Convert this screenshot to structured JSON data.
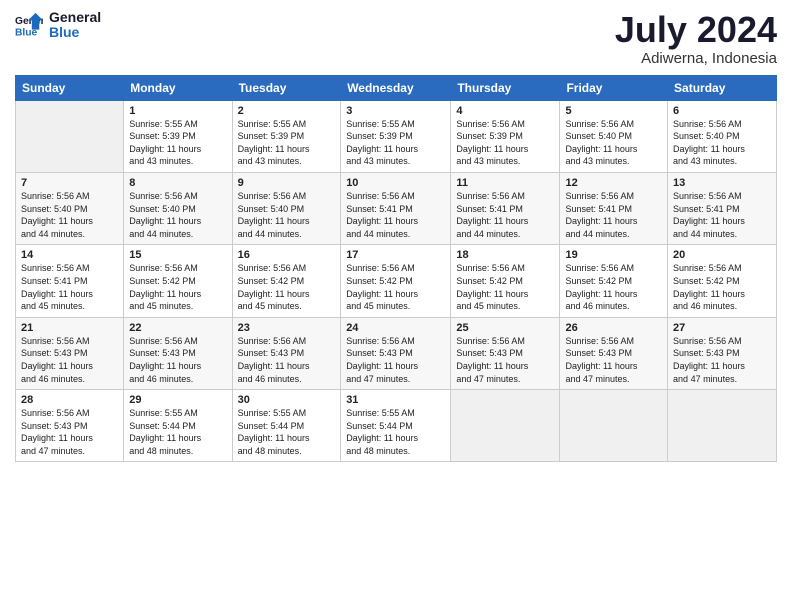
{
  "header": {
    "logo_line1": "General",
    "logo_line2": "Blue",
    "title": "July 2024",
    "location": "Adiwerna, Indonesia"
  },
  "weekdays": [
    "Sunday",
    "Monday",
    "Tuesday",
    "Wednesday",
    "Thursday",
    "Friday",
    "Saturday"
  ],
  "weeks": [
    [
      {
        "day": "",
        "sunrise": "",
        "sunset": "",
        "daylight": ""
      },
      {
        "day": "1",
        "sunrise": "Sunrise: 5:55 AM",
        "sunset": "Sunset: 5:39 PM",
        "daylight": "Daylight: 11 hours and 43 minutes."
      },
      {
        "day": "2",
        "sunrise": "Sunrise: 5:55 AM",
        "sunset": "Sunset: 5:39 PM",
        "daylight": "Daylight: 11 hours and 43 minutes."
      },
      {
        "day": "3",
        "sunrise": "Sunrise: 5:55 AM",
        "sunset": "Sunset: 5:39 PM",
        "daylight": "Daylight: 11 hours and 43 minutes."
      },
      {
        "day": "4",
        "sunrise": "Sunrise: 5:56 AM",
        "sunset": "Sunset: 5:39 PM",
        "daylight": "Daylight: 11 hours and 43 minutes."
      },
      {
        "day": "5",
        "sunrise": "Sunrise: 5:56 AM",
        "sunset": "Sunset: 5:40 PM",
        "daylight": "Daylight: 11 hours and 43 minutes."
      },
      {
        "day": "6",
        "sunrise": "Sunrise: 5:56 AM",
        "sunset": "Sunset: 5:40 PM",
        "daylight": "Daylight: 11 hours and 43 minutes."
      }
    ],
    [
      {
        "day": "7",
        "sunrise": "Sunrise: 5:56 AM",
        "sunset": "Sunset: 5:40 PM",
        "daylight": "Daylight: 11 hours and 44 minutes."
      },
      {
        "day": "8",
        "sunrise": "Sunrise: 5:56 AM",
        "sunset": "Sunset: 5:40 PM",
        "daylight": "Daylight: 11 hours and 44 minutes."
      },
      {
        "day": "9",
        "sunrise": "Sunrise: 5:56 AM",
        "sunset": "Sunset: 5:40 PM",
        "daylight": "Daylight: 11 hours and 44 minutes."
      },
      {
        "day": "10",
        "sunrise": "Sunrise: 5:56 AM",
        "sunset": "Sunset: 5:41 PM",
        "daylight": "Daylight: 11 hours and 44 minutes."
      },
      {
        "day": "11",
        "sunrise": "Sunrise: 5:56 AM",
        "sunset": "Sunset: 5:41 PM",
        "daylight": "Daylight: 11 hours and 44 minutes."
      },
      {
        "day": "12",
        "sunrise": "Sunrise: 5:56 AM",
        "sunset": "Sunset: 5:41 PM",
        "daylight": "Daylight: 11 hours and 44 minutes."
      },
      {
        "day": "13",
        "sunrise": "Sunrise: 5:56 AM",
        "sunset": "Sunset: 5:41 PM",
        "daylight": "Daylight: 11 hours and 44 minutes."
      }
    ],
    [
      {
        "day": "14",
        "sunrise": "Sunrise: 5:56 AM",
        "sunset": "Sunset: 5:41 PM",
        "daylight": "Daylight: 11 hours and 45 minutes."
      },
      {
        "day": "15",
        "sunrise": "Sunrise: 5:56 AM",
        "sunset": "Sunset: 5:42 PM",
        "daylight": "Daylight: 11 hours and 45 minutes."
      },
      {
        "day": "16",
        "sunrise": "Sunrise: 5:56 AM",
        "sunset": "Sunset: 5:42 PM",
        "daylight": "Daylight: 11 hours and 45 minutes."
      },
      {
        "day": "17",
        "sunrise": "Sunrise: 5:56 AM",
        "sunset": "Sunset: 5:42 PM",
        "daylight": "Daylight: 11 hours and 45 minutes."
      },
      {
        "day": "18",
        "sunrise": "Sunrise: 5:56 AM",
        "sunset": "Sunset: 5:42 PM",
        "daylight": "Daylight: 11 hours and 45 minutes."
      },
      {
        "day": "19",
        "sunrise": "Sunrise: 5:56 AM",
        "sunset": "Sunset: 5:42 PM",
        "daylight": "Daylight: 11 hours and 46 minutes."
      },
      {
        "day": "20",
        "sunrise": "Sunrise: 5:56 AM",
        "sunset": "Sunset: 5:42 PM",
        "daylight": "Daylight: 11 hours and 46 minutes."
      }
    ],
    [
      {
        "day": "21",
        "sunrise": "Sunrise: 5:56 AM",
        "sunset": "Sunset: 5:43 PM",
        "daylight": "Daylight: 11 hours and 46 minutes."
      },
      {
        "day": "22",
        "sunrise": "Sunrise: 5:56 AM",
        "sunset": "Sunset: 5:43 PM",
        "daylight": "Daylight: 11 hours and 46 minutes."
      },
      {
        "day": "23",
        "sunrise": "Sunrise: 5:56 AM",
        "sunset": "Sunset: 5:43 PM",
        "daylight": "Daylight: 11 hours and 46 minutes."
      },
      {
        "day": "24",
        "sunrise": "Sunrise: 5:56 AM",
        "sunset": "Sunset: 5:43 PM",
        "daylight": "Daylight: 11 hours and 47 minutes."
      },
      {
        "day": "25",
        "sunrise": "Sunrise: 5:56 AM",
        "sunset": "Sunset: 5:43 PM",
        "daylight": "Daylight: 11 hours and 47 minutes."
      },
      {
        "day": "26",
        "sunrise": "Sunrise: 5:56 AM",
        "sunset": "Sunset: 5:43 PM",
        "daylight": "Daylight: 11 hours and 47 minutes."
      },
      {
        "day": "27",
        "sunrise": "Sunrise: 5:56 AM",
        "sunset": "Sunset: 5:43 PM",
        "daylight": "Daylight: 11 hours and 47 minutes."
      }
    ],
    [
      {
        "day": "28",
        "sunrise": "Sunrise: 5:56 AM",
        "sunset": "Sunset: 5:43 PM",
        "daylight": "Daylight: 11 hours and 47 minutes."
      },
      {
        "day": "29",
        "sunrise": "Sunrise: 5:55 AM",
        "sunset": "Sunset: 5:44 PM",
        "daylight": "Daylight: 11 hours and 48 minutes."
      },
      {
        "day": "30",
        "sunrise": "Sunrise: 5:55 AM",
        "sunset": "Sunset: 5:44 PM",
        "daylight": "Daylight: 11 hours and 48 minutes."
      },
      {
        "day": "31",
        "sunrise": "Sunrise: 5:55 AM",
        "sunset": "Sunset: 5:44 PM",
        "daylight": "Daylight: 11 hours and 48 minutes."
      },
      {
        "day": "",
        "sunrise": "",
        "sunset": "",
        "daylight": ""
      },
      {
        "day": "",
        "sunrise": "",
        "sunset": "",
        "daylight": ""
      },
      {
        "day": "",
        "sunrise": "",
        "sunset": "",
        "daylight": ""
      }
    ]
  ]
}
